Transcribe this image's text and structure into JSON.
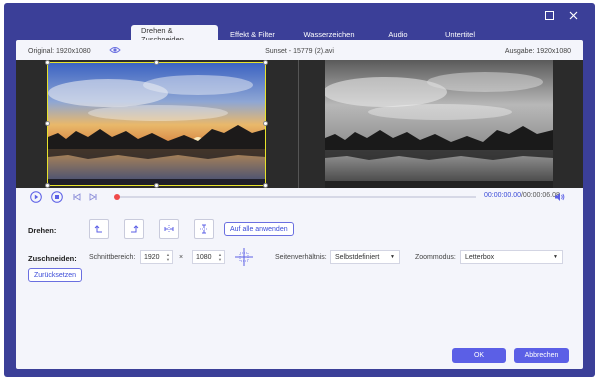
{
  "tabs": [
    {
      "label": "Drehen & Zuschneiden",
      "active": true
    },
    {
      "label": "Effekt & Filter",
      "active": false
    },
    {
      "label": "Wasserzeichen",
      "active": false
    },
    {
      "label": "Audio",
      "active": false
    },
    {
      "label": "Untertitel",
      "active": false
    }
  ],
  "header": {
    "original": "Original: 1920x1080",
    "filename": "Sunset - 15779 (2).avi",
    "output": "Ausgabe: 1920x1080"
  },
  "player": {
    "time_current": "00:00:00.00",
    "time_total": "/00:00:06.08",
    "progress": 0
  },
  "rotate": {
    "label": "Drehen:",
    "apply_all": "Auf alle anwenden"
  },
  "crop": {
    "label": "Zuschneiden:",
    "area_label": "Schnittbereich:",
    "width": "1920",
    "times": "×",
    "height": "1080",
    "ratio_label": "Seitenverhältnis:",
    "ratio_value": "Selbstdefiniert",
    "zoom_label": "Zoommodus:",
    "zoom_value": "Letterbox",
    "reset": "Zurücksetzen"
  },
  "footer": {
    "ok": "OK",
    "cancel": "Abbrechen"
  },
  "colors": {
    "frame": "#3b3f98",
    "accent": "#5b5fe6",
    "crop_border": "#e8e32b",
    "progress_dot": "#f04a4a"
  }
}
